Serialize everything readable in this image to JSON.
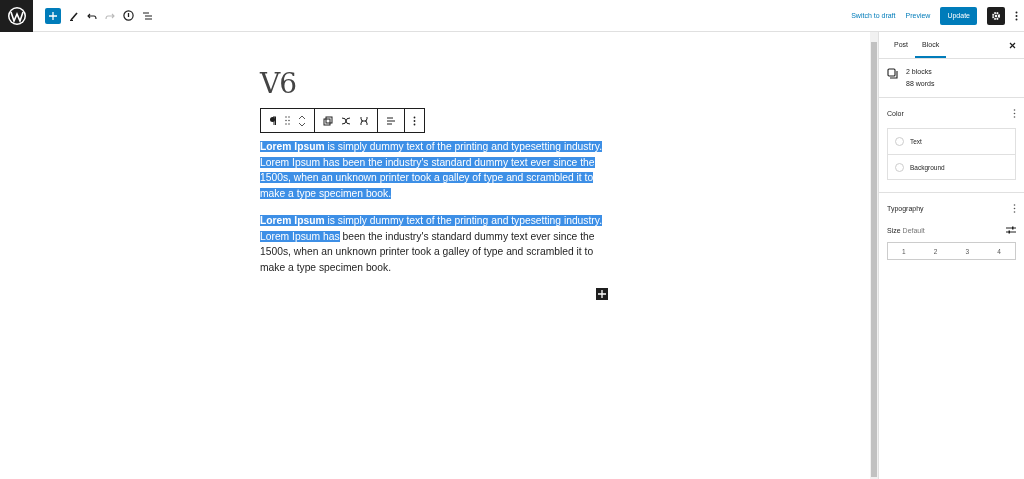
{
  "topbar": {
    "actions": [
      {
        "label": "Switch to draft",
        "kind": "link"
      },
      {
        "label": "Preview",
        "kind": "link"
      },
      {
        "label": "Update",
        "kind": "primary"
      }
    ]
  },
  "document": {
    "title": "V6",
    "paragraphs": [
      {
        "segments": [
          {
            "text": "Lorem Ipsum",
            "bold": true,
            "selected": true
          },
          {
            "text": " is simply dummy text of the printing and typesetting industry. Lorem Ipsum has been the industry's standard dummy text ever since the 1500s, when an unknown printer took a galley of type and scrambled it to make a type specimen book.",
            "bold": false,
            "selected": true
          }
        ]
      },
      {
        "segments": [
          {
            "text": "Lorem Ipsum",
            "bold": true,
            "selected": true
          },
          {
            "text": " is simply dummy text of the printing and typesetting industry. Lorem Ipsum has",
            "bold": false,
            "selected": true
          },
          {
            "text": " been the industry's standard dummy text ever since the 1500s, when an unknown printer took a galley of type and scrambled it to make a type specimen book.",
            "bold": false,
            "selected": false
          }
        ]
      }
    ]
  },
  "sidebar": {
    "tabs": [
      {
        "label": "Post",
        "selected": false
      },
      {
        "label": "Block",
        "selected": true
      }
    ],
    "block_card": {
      "title": "2 blocks",
      "words": "88 words"
    },
    "color": {
      "title": "Color",
      "items": [
        {
          "label": "Text"
        },
        {
          "label": "Background"
        }
      ]
    },
    "typography": {
      "title": "Typography",
      "size_label": "Size",
      "size_value": "Default",
      "sizes": [
        "1",
        "2",
        "3",
        "4"
      ]
    }
  }
}
